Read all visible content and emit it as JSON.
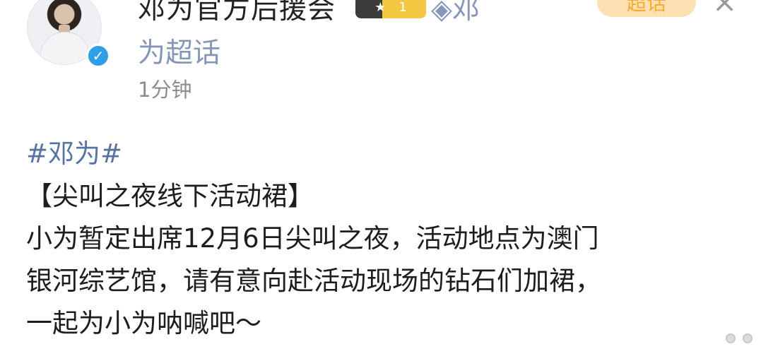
{
  "header": {
    "username": "邓为官方后援会",
    "rank_badge_left": "★",
    "rank_badge_right": "1",
    "topic_link_line1": "◈邓",
    "topic_link_line2": "为超话",
    "super_topic_button": "超话",
    "close_symbol": "×",
    "timestamp": "1分钟"
  },
  "post": {
    "hashtag": "#邓为#",
    "lines": [
      "【尖叫之夜线下活动裙】",
      "小为暂定出席12月6日尖叫之夜，活动地点为澳门",
      "银河综艺馆，请有意向赴活动现场的钻石们加裙，",
      "一起为小为呐喊吧～"
    ]
  },
  "colors": {
    "verified": "#2f9ee8",
    "link": "#8597b8",
    "hashtag": "#5573a3",
    "super_topic_bg": "#fde1b2",
    "super_topic_text": "#f6ad36"
  }
}
